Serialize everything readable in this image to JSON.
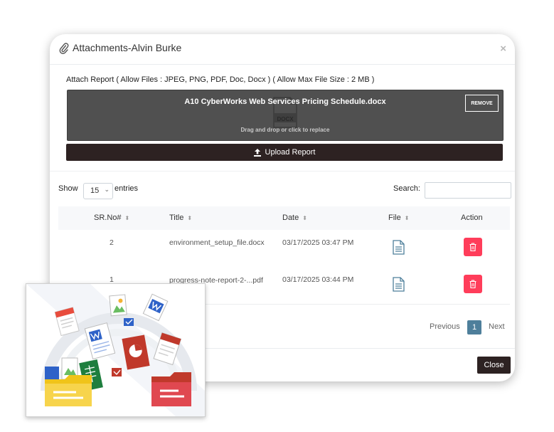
{
  "modal": {
    "title": "Attachments-Alvin Burke",
    "attach_label": "Attach Report ( Allow Files : JPEG, PNG, PDF, Doc, Docx ) ( Allow Max File Size : 2 MB )",
    "dropzone": {
      "file_name": "A10 CyberWorks Web Services Pricing Schedule.docx",
      "file_type": "DOCX",
      "message": "Drag and drop or click to replace",
      "remove_label": "REMOVE"
    },
    "upload_label": "Upload Report",
    "close_label": "Close"
  },
  "table_controls": {
    "show_label": "Show",
    "page_length": "15",
    "entries_label": "entries",
    "search_label": "Search:"
  },
  "table": {
    "columns": [
      "SR.No#",
      "Title",
      "Date",
      "File",
      "Action"
    ],
    "rows": [
      {
        "sr": "2",
        "title": "environment_setup_file.docx",
        "date": "03/17/2025 03:47 PM"
      },
      {
        "sr": "1",
        "title": "progress-note-report-2-...pdf",
        "date": "03/17/2025 03:44 PM"
      }
    ]
  },
  "pagination": {
    "previous": "Previous",
    "current": "1",
    "next": "Next"
  },
  "colors": {
    "dark_button": "#2d2222",
    "delete": "#ff3d5a",
    "page_active": "#4e7f9b",
    "dropzone": "#505050"
  },
  "icons": [
    "paperclip-icon",
    "close-icon",
    "upload-icon",
    "document-icon",
    "trash-icon",
    "file-stack-illustration"
  ]
}
